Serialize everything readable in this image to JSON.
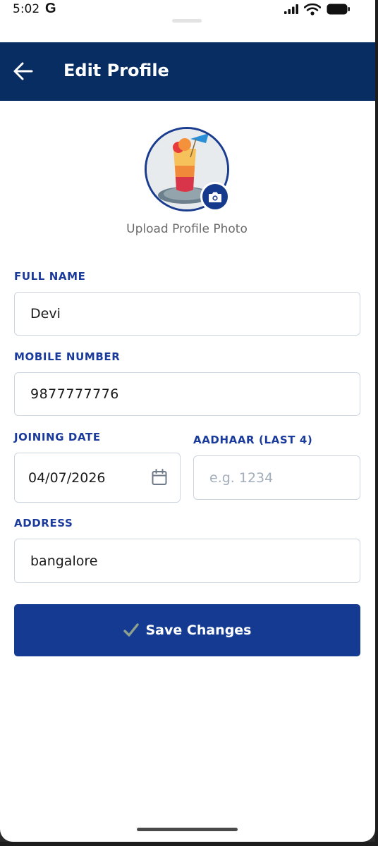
{
  "status_bar": {
    "time": "5:02",
    "google_glyph": "G"
  },
  "header": {
    "title": "Edit Profile",
    "back_icon": "arrow-left-icon"
  },
  "profile": {
    "upload_label": "Upload Profile Photo",
    "camera_icon": "camera-icon"
  },
  "form": {
    "full_name": {
      "label": "FULL NAME",
      "value": "Devi"
    },
    "mobile": {
      "label": "MOBILE NUMBER",
      "value": "9877777776"
    },
    "joining_date": {
      "label": "JOINING DATE",
      "value": "04/07/2026",
      "icon": "calendar-icon"
    },
    "aadhaar": {
      "label": "AADHAAR (LAST 4)",
      "value": "",
      "placeholder": "e.g. 1234"
    },
    "address": {
      "label": "ADDRESS",
      "value": "bangalore"
    }
  },
  "save_button": {
    "label": "Save Changes",
    "icon": "check-icon"
  },
  "colors": {
    "header_bg": "#082d62",
    "accent": "#143a92",
    "label": "#1a3a9c"
  }
}
